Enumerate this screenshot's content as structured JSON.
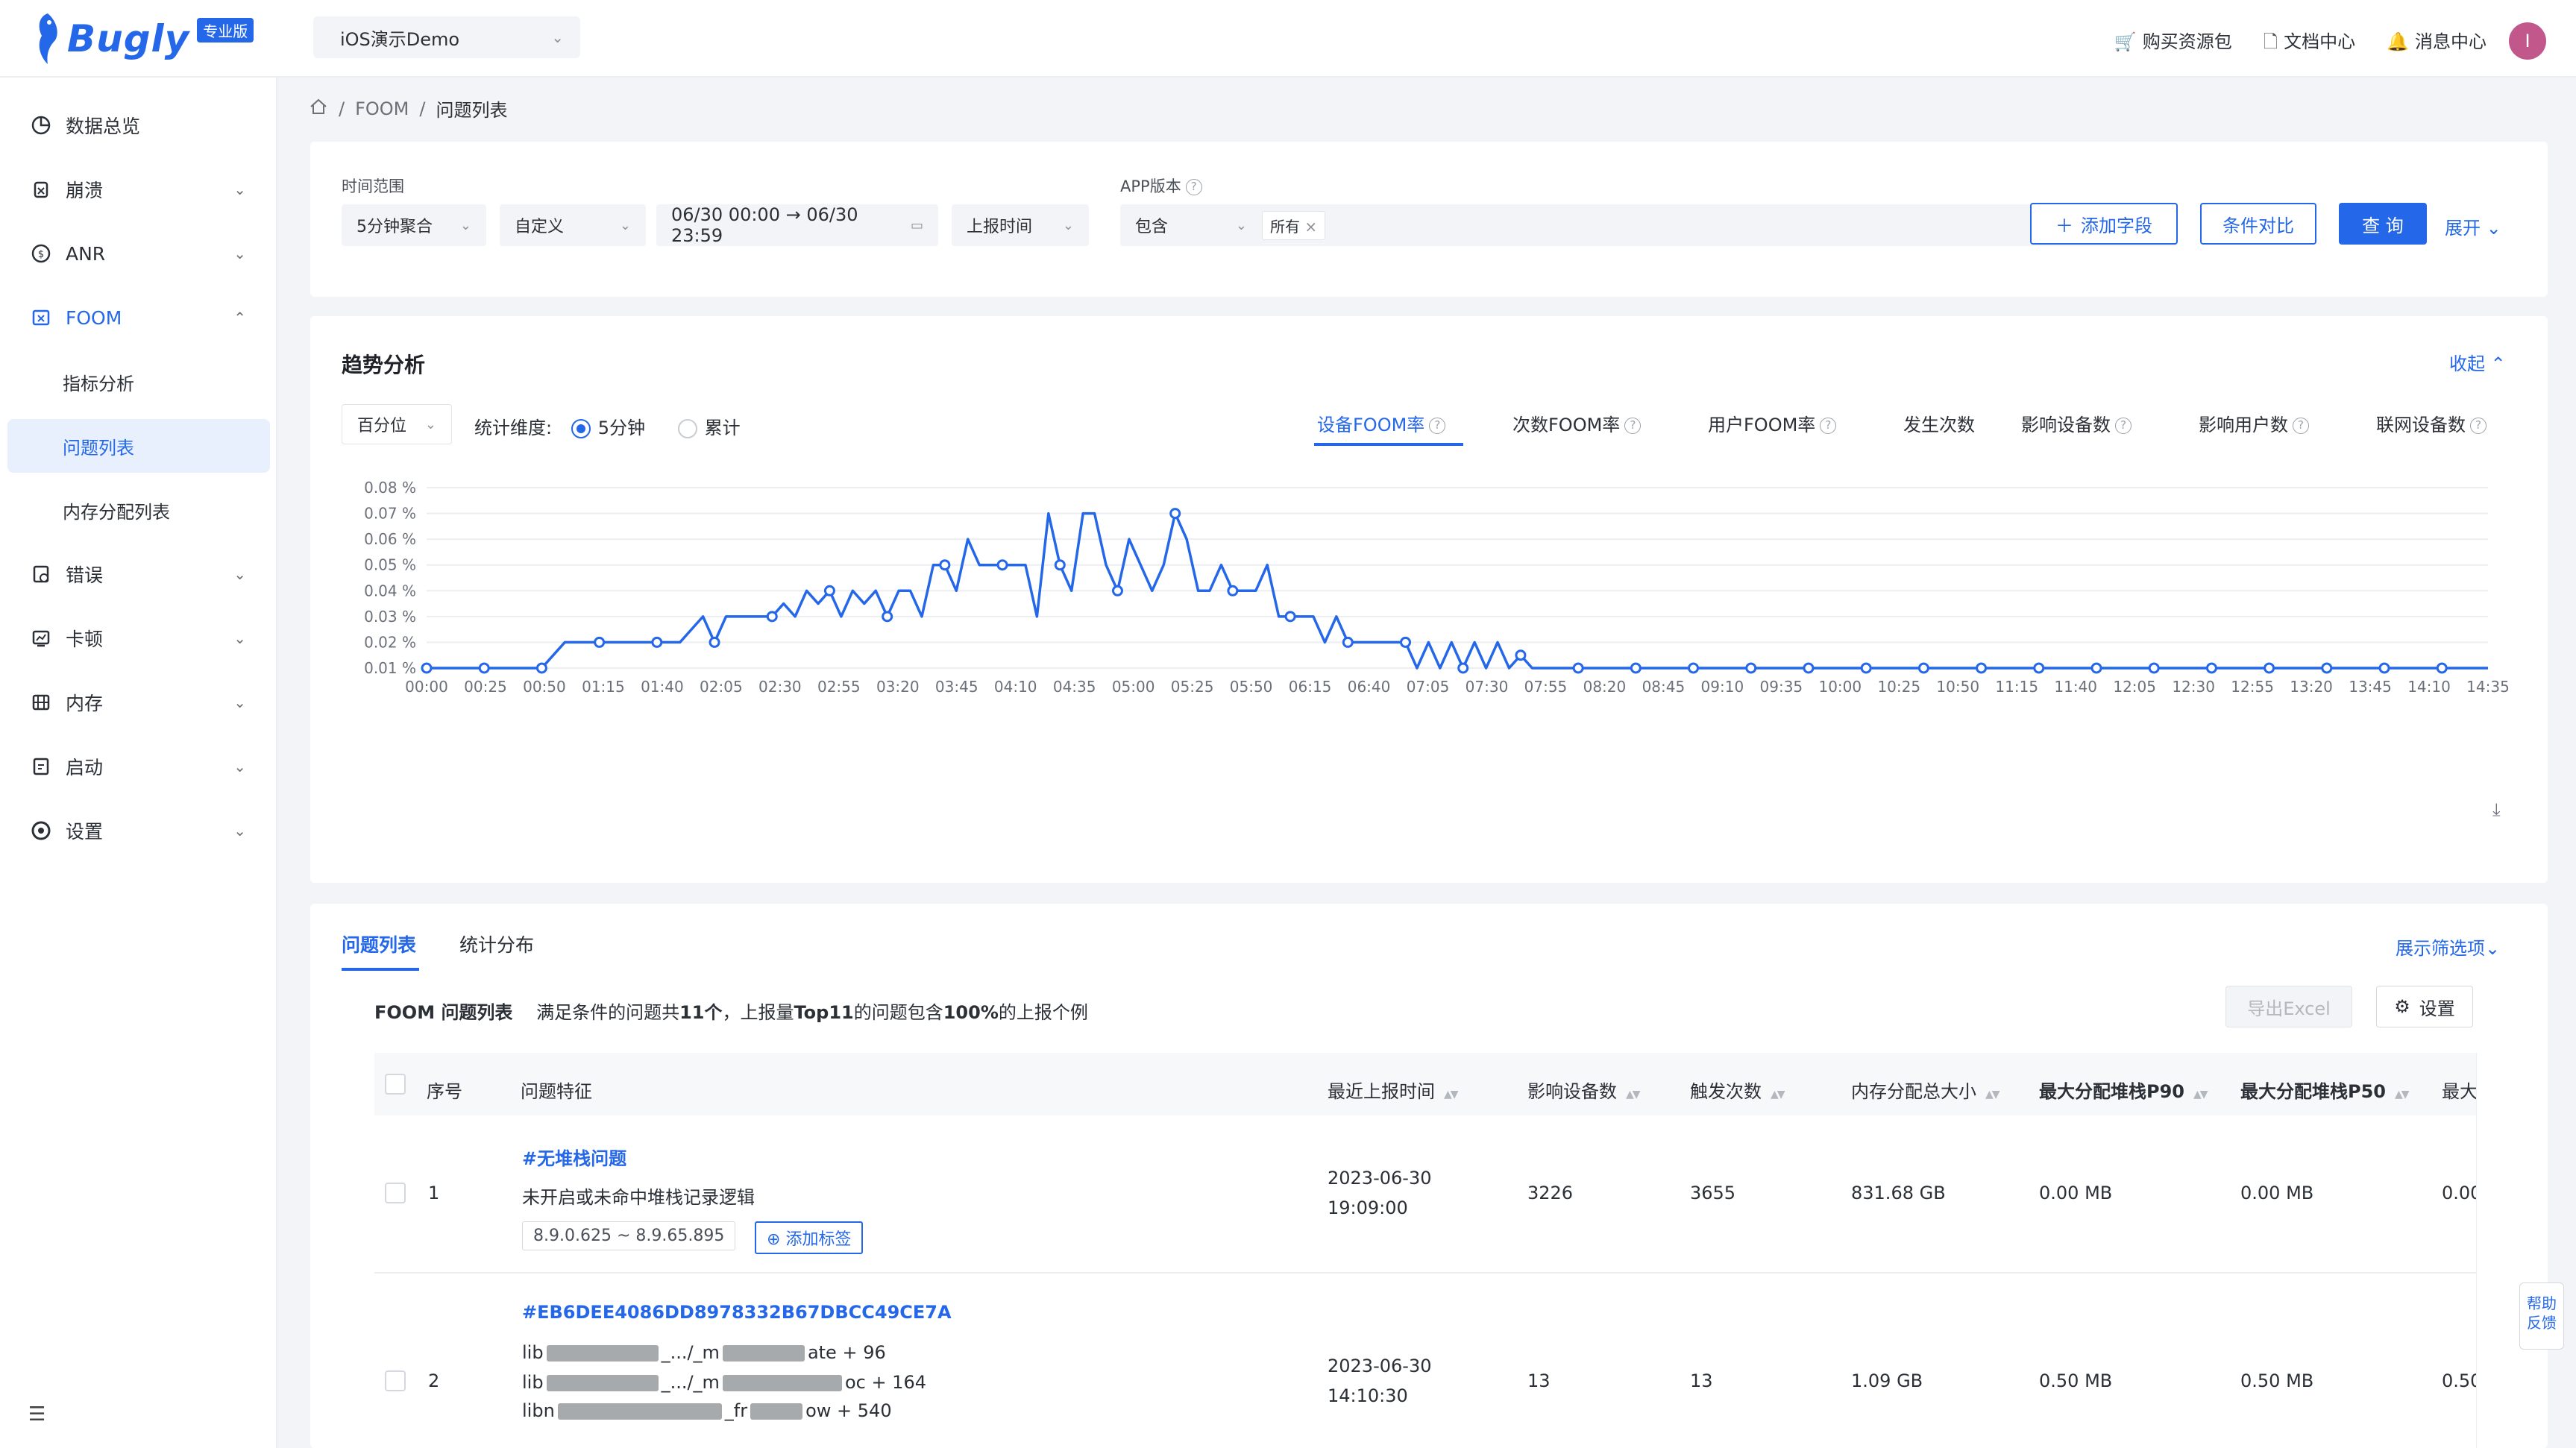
{
  "brand": {
    "name": "Bugly",
    "badge": "专业版"
  },
  "app_selector": {
    "value": "iOS演示Demo",
    "icon": "apple-icon"
  },
  "top_links": [
    {
      "label": "购买资源包",
      "icon": "cart-icon"
    },
    {
      "label": "文档中心",
      "icon": "document-icon"
    },
    {
      "label": "消息中心",
      "icon": "bell-icon"
    }
  ],
  "avatar": {
    "initial": "I",
    "color": "#c2578c"
  },
  "sidebar": {
    "items": [
      {
        "label": "数据总览",
        "icon": "pie-chart-icon",
        "chevron": false
      },
      {
        "label": "崩溃",
        "icon": "bug-icon",
        "chevron": true
      },
      {
        "label": "ANR",
        "icon": "anr-icon",
        "chevron": true
      },
      {
        "label": "FOOM",
        "icon": "foom-icon",
        "chevron": true,
        "expanded": true
      },
      {
        "label": "错误",
        "icon": "error-icon",
        "chevron": true
      },
      {
        "label": "卡顿",
        "icon": "lag-icon",
        "chevron": true
      },
      {
        "label": "内存",
        "icon": "memory-icon",
        "chevron": true
      },
      {
        "label": "启动",
        "icon": "launch-icon",
        "chevron": true
      },
      {
        "label": "设置",
        "icon": "settings-icon",
        "chevron": true
      }
    ],
    "foom_sub": [
      {
        "label": "指标分析",
        "selected": false
      },
      {
        "label": "问题列表",
        "selected": true
      },
      {
        "label": "内存分配列表",
        "selected": false
      }
    ]
  },
  "breadcrumb": {
    "items": [
      "FOOM",
      "问题列表"
    ]
  },
  "filters": {
    "time_range_label": "时间范围",
    "aggregation": "5分钟聚合",
    "mode": "自定义",
    "date_range": "06/30 00:00 → 06/30 23:59",
    "time_type": "上报时间",
    "app_version_label": "APP版本",
    "version_op": "包含",
    "version_tag": "所有",
    "add_field": "添加字段",
    "compare": "条件对比",
    "query": "查 询",
    "expand": "展开"
  },
  "trend": {
    "title": "趋势分析",
    "collapse": "收起",
    "stat_select": "百分位",
    "dimension_label": "统计维度:",
    "radio_options": [
      "5分钟",
      "累计"
    ],
    "metric_tabs": [
      "设备FOOM率",
      "次数FOOM率",
      "用户FOOM率",
      "发生次数",
      "影响设备数",
      "影响用户数",
      "联网设备数"
    ]
  },
  "chart_data": {
    "type": "line",
    "title": "",
    "xlabel": "",
    "ylabel": "",
    "ylim": [
      0.01,
      0.08
    ],
    "y_ticks": [
      "0.01 %",
      "0.02 %",
      "0.03 %",
      "0.04 %",
      "0.05 %",
      "0.06 %",
      "0.07 %",
      "0.08 %"
    ],
    "x_ticks": [
      "00:00",
      "00:25",
      "00:50",
      "01:15",
      "01:40",
      "02:05",
      "02:30",
      "02:55",
      "03:20",
      "03:45",
      "04:10",
      "04:35",
      "05:00",
      "05:25",
      "05:50",
      "06:15",
      "06:40",
      "07:05",
      "07:30",
      "07:55",
      "08:20",
      "08:45",
      "09:10",
      "09:35",
      "10:00",
      "10:25",
      "10:50",
      "11:15",
      "11:40",
      "12:05",
      "12:30",
      "12:55",
      "13:20",
      "13:45",
      "14:10",
      "14:35"
    ],
    "series": [
      {
        "color": "#2467e8",
        "values": [
          0.01,
          0.01,
          0.01,
          0.01,
          0.01,
          0.01,
          0.01,
          0.01,
          0.01,
          0.01,
          0.01,
          0.015,
          0.02,
          0.02,
          0.02,
          0.02,
          0.02,
          0.02,
          0.02,
          0.02,
          0.02,
          0.02,
          0.02,
          0.025,
          0.03,
          0.02,
          0.03,
          0.03,
          0.03,
          0.03,
          0.03,
          0.035,
          0.03,
          0.04,
          0.035,
          0.04,
          0.03,
          0.04,
          0.035,
          0.04,
          0.03,
          0.04,
          0.04,
          0.03,
          0.05,
          0.05,
          0.04,
          0.06,
          0.05,
          0.05,
          0.05,
          0.05,
          0.05,
          0.03,
          0.07,
          0.05,
          0.04,
          0.07,
          0.07,
          0.05,
          0.04,
          0.06,
          0.05,
          0.04,
          0.05,
          0.07,
          0.06,
          0.04,
          0.04,
          0.05,
          0.04,
          0.04,
          0.04,
          0.05,
          0.03,
          0.03,
          0.03,
          0.03,
          0.02,
          0.03,
          0.02,
          0.02,
          0.02,
          0.02,
          0.02,
          0.02,
          0.01,
          0.02,
          0.01,
          0.02,
          0.01,
          0.02,
          0.01,
          0.02,
          0.01,
          0.015,
          0.01,
          0.01,
          0.01,
          0.01,
          0.01,
          0.01,
          0.01,
          0.01,
          0.01,
          0.01,
          0.01,
          0.01,
          0.01,
          0.01,
          0.01,
          0.01,
          0.01,
          0.01,
          0.01,
          0.01,
          0.01,
          0.01,
          0.01,
          0.01,
          0.01,
          0.01,
          0.01,
          0.01,
          0.01,
          0.01,
          0.01,
          0.01,
          0.01,
          0.01,
          0.01,
          0.01,
          0.01,
          0.01,
          0.01,
          0.01,
          0.01,
          0.01,
          0.01,
          0.01,
          0.01,
          0.01,
          0.01,
          0.01,
          0.01,
          0.01,
          0.01,
          0.01,
          0.01,
          0.01,
          0.01,
          0.01,
          0.01,
          0.01,
          0.01,
          0.01,
          0.01,
          0.01,
          0.01,
          0.01,
          0.01,
          0.01,
          0.01,
          0.01,
          0.01,
          0.01,
          0.01,
          0.01,
          0.01,
          0.01,
          0.01,
          0.01,
          0.01,
          0.01,
          0.01,
          0.01,
          0.01,
          0.01,
          0.01,
          0.01
        ]
      }
    ],
    "grid": true
  },
  "issue_list": {
    "tabs": [
      "问题列表",
      "统计分布"
    ],
    "show_filters": "展示筛选项",
    "title": "FOOM 问题列表",
    "summary_pre": "满足条件的问题共",
    "summary_count": "11个",
    "summary_mid": "，上报量",
    "summary_top": "Top11",
    "summary_mid2": "的问题包含",
    "summary_pct": "100%",
    "summary_post": "的上报个例",
    "export": "导出Excel",
    "settings": "设置",
    "columns": [
      "序号",
      "问题特征",
      "最近上报时间",
      "影响设备数",
      "触发次数",
      "内存分配总大小",
      "最大分配堆栈P90",
      "最大分配堆栈P50",
      "最大"
    ],
    "rows": [
      {
        "index": "1",
        "title": "#无堆栈问题",
        "desc": "未开启或未命中堆栈记录逻辑",
        "version": "8.9.0.625 ~ 8.9.65.895",
        "add_tag": "添加标签",
        "date": "2023-06-30",
        "time": "19:09:00",
        "devices": "3226",
        "count": "3655",
        "total": "831.68 GB",
        "p90": "0.00 MB",
        "p50": "0.00 MB",
        "max": "0.00"
      },
      {
        "index": "2",
        "title": "#EB6DEE4086DD8978332B67DBCC49CE7A",
        "stack": [
          "ate + 96",
          "oc + 164",
          "ow + 540"
        ],
        "date": "2023-06-30",
        "time": "14:10:30",
        "devices": "13",
        "count": "13",
        "total": "1.09 GB",
        "p90": "0.50 MB",
        "p50": "0.50 MB",
        "max": "0.50"
      }
    ]
  },
  "help": "帮助反馈"
}
